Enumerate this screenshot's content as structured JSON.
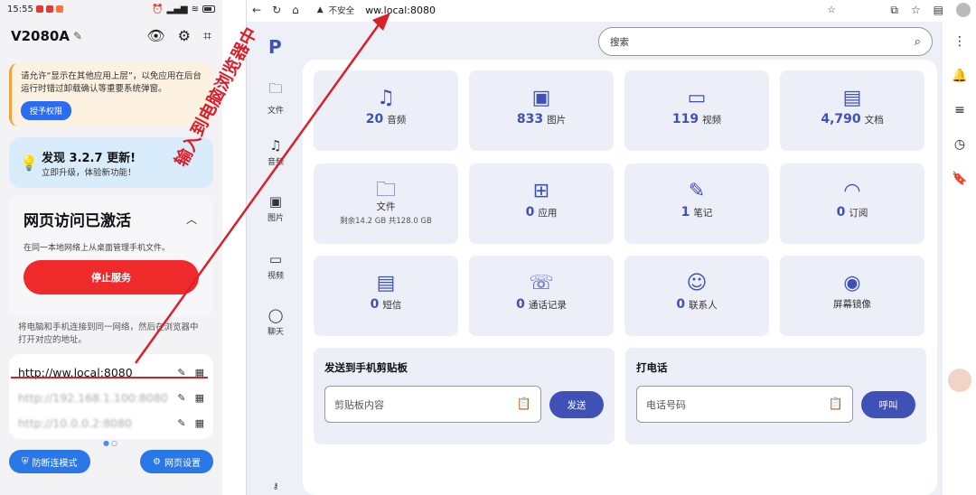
{
  "phone": {
    "status": {
      "time": "15:55"
    },
    "device_name": "V2080A",
    "warning": {
      "text": "请允许“显示在其他应用上层”，以免应用在后台运行时错过卸载确认等重要系统弹窗。",
      "button": "授予权限"
    },
    "update": {
      "title": "发现 3.2.7 更新!",
      "subtitle": "立即升级，体验新功能！"
    },
    "web_access": {
      "title": "网页访问已激活",
      "subtitle": "在同一本地网络上从桌面管理手机文件。",
      "stop_button": "停止服务"
    },
    "hint": "将电脑和手机连接到同一网络，然后在浏览器中打开对应的地址。",
    "urls": [
      "http://ww.local:8080",
      "http://192.168.1.100:8080",
      "http://10.0.0.2:8080"
    ],
    "buttons": {
      "anti_disconnect": "防断连模式",
      "web_settings": "网页设置"
    },
    "colors": {
      "stop": "#ee2a2a",
      "primary": "#2a78e8"
    }
  },
  "browser": {
    "insecure_label": "不安全",
    "url": "ww.local:8080",
    "search_placeholder": "搜索",
    "nav": [
      {
        "label": "文件",
        "icon": "folder-icon"
      },
      {
        "label": "音频",
        "icon": "music-icon"
      },
      {
        "label": "图片",
        "icon": "image-icon"
      },
      {
        "label": "视频",
        "icon": "video-icon"
      },
      {
        "label": "聊天",
        "icon": "chat-icon"
      }
    ],
    "tiles": [
      {
        "count": "20",
        "label": "音频"
      },
      {
        "count": "833",
        "label": "图片"
      },
      {
        "count": "119",
        "label": "视频"
      },
      {
        "count": "4,790",
        "label": "文档"
      },
      {
        "count": "",
        "label": "文件",
        "sub": "剩余14.2 GB 共128.0 GB"
      },
      {
        "count": "0",
        "label": "应用"
      },
      {
        "count": "1",
        "label": "笔记"
      },
      {
        "count": "0",
        "label": "订阅"
      },
      {
        "count": "0",
        "label": "短信"
      },
      {
        "count": "0",
        "label": "通话记录"
      },
      {
        "count": "0",
        "label": "联系人"
      },
      {
        "count": "",
        "label": "屏幕镜像"
      }
    ],
    "clipboard": {
      "title": "发送到手机剪贴板",
      "placeholder": "剪贴板内容",
      "button": "发送"
    },
    "call": {
      "title": "打电话",
      "placeholder": "电话号码",
      "button": "呼叫"
    },
    "accent": "#3f51b5"
  },
  "annotation": {
    "text": "输入到电脑浏览器中",
    "color": "#d9202a"
  }
}
